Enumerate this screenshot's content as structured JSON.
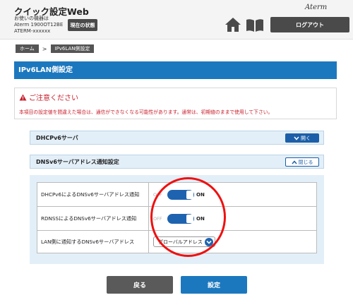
{
  "header": {
    "app_title": "クイック設定Web",
    "device_info": [
      "お使いの機器は",
      "Aterm 1900OT12BE",
      "ATERM-xxxxxx"
    ],
    "status_button": "現在の状態",
    "brand": "Aterm",
    "logout_button": "ログアウト"
  },
  "breadcrumb": {
    "home": "ホーム",
    "separator": ">",
    "current": "IPv6LAN側設定"
  },
  "page_title": "IPv6LAN側設定",
  "caution": {
    "title": "ご注意ください",
    "text": "本項目の設定値を間違えた場合は、通信ができなくなる可能性があります。通常は、初期値のままで使用して下さい。"
  },
  "panels": {
    "dhcpv6": {
      "title": "DHCPv6サーバ",
      "button": "開く"
    },
    "dnsv6": {
      "title": "DNSv6サーバアドレス通知設定",
      "button": "閉じる"
    }
  },
  "settings": {
    "dhcpv6_notify": {
      "label": "DHCPv6によるDNSv6サーバアドレス通知",
      "off_label": "OFF",
      "on_label": "ON"
    },
    "rdnss_notify": {
      "label": "RDNSSによるDNSv6サーバアドレス通知",
      "off_label": "OFF",
      "on_label": "ON"
    },
    "lan_address": {
      "label": "LAN側に通知するDNSv6サーバアドレス",
      "value": "グローバルアドレス"
    }
  },
  "buttons": {
    "back": "戻る",
    "set": "設定"
  },
  "colors": {
    "primary": "#1c78be",
    "dark_button": "#4a4a4a",
    "warning": "#c8202c",
    "panel_bg": "#e3eff8",
    "highlight_circle": "#ee1111"
  }
}
